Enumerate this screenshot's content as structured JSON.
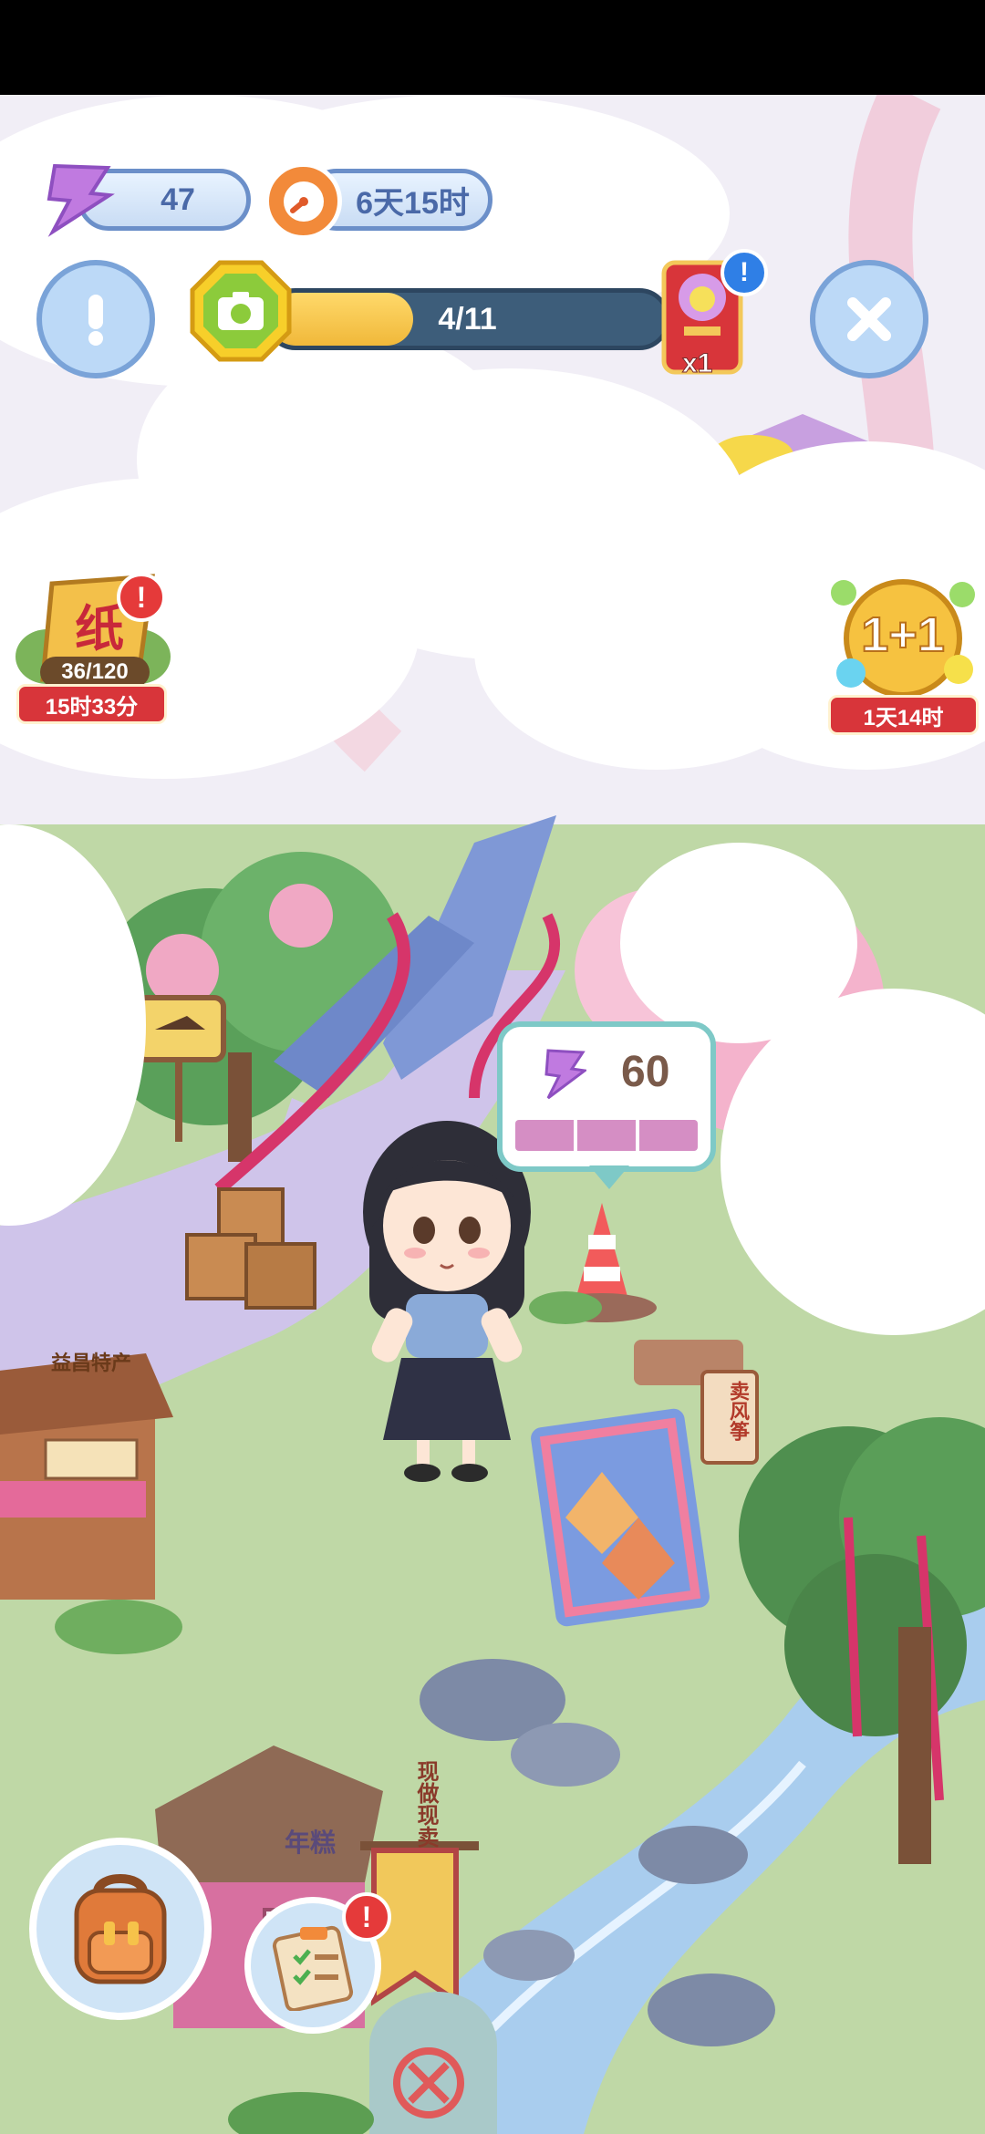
{
  "hud": {
    "energy": {
      "icon": "energy-bolt-icon",
      "value": "47"
    },
    "timer": {
      "icon": "stopwatch-icon",
      "value": "6天15时"
    },
    "camera_progress": {
      "icon": "camera-icon",
      "text": "4/11",
      "fraction": 0.364
    },
    "gift_bag": {
      "icon": "red-gift-bag-icon",
      "count": "x1"
    },
    "info_button": {
      "icon": "exclamation-icon"
    },
    "close_button": {
      "icon": "close-icon"
    }
  },
  "events": {
    "paper_event": {
      "icon_text": "纸",
      "progress": "36/120",
      "timer": "15时33分"
    },
    "double_event": {
      "icon_text": "1+1",
      "timer": "1天14时"
    }
  },
  "scene_signs": {
    "stall_left": "益昌特产",
    "sign_right": "卖风筝",
    "banner": "现做现卖",
    "stall_bottom": "年糕"
  },
  "cost_bubble": {
    "icon": "energy-bolt-icon",
    "value": "60",
    "segments": 3
  },
  "bottom_buttons": {
    "backpack": {
      "icon": "backpack-icon"
    },
    "tasks": {
      "icon": "clipboard-checklist-icon"
    }
  },
  "badge_mark": "!",
  "colors": {
    "accent_blue": "#6b8fc9",
    "progress_yellow": "#f6c84b",
    "energy_purple": "#c07ae0",
    "event_red": "#d8353a"
  }
}
